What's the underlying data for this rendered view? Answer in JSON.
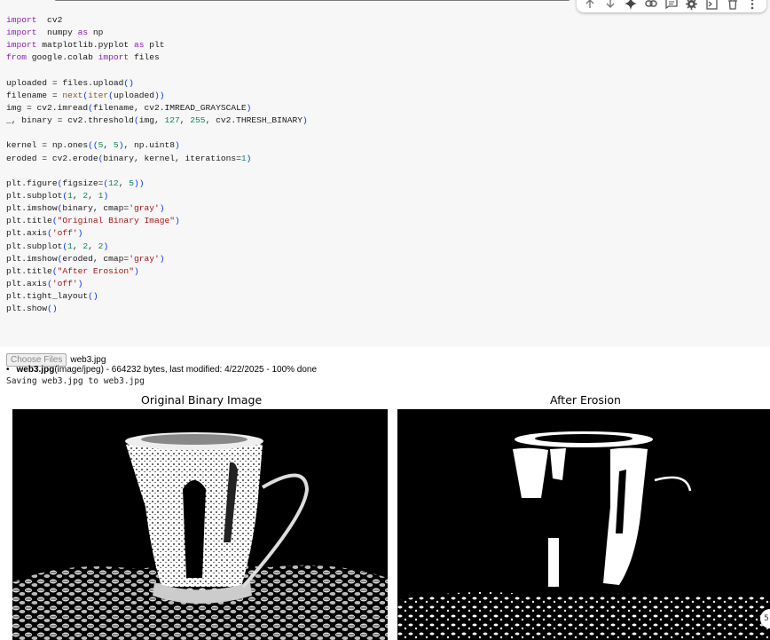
{
  "toolbar": {
    "icons": [
      "arrow-up-icon",
      "arrow-down-icon",
      "gemini-spark-icon",
      "link-icon",
      "comment-icon",
      "gear-icon",
      "mirror-cell-icon",
      "trash-icon",
      "more-vert-icon"
    ]
  },
  "code_lines": [
    [
      [
        "kw",
        "import"
      ],
      [
        "",
        "  cv2"
      ]
    ],
    [
      [
        "kw",
        "import"
      ],
      [
        "",
        "  numpy "
      ],
      [
        "kw",
        "as"
      ],
      [
        "",
        " np"
      ]
    ],
    [
      [
        "kw",
        "import"
      ],
      [
        "",
        " matplotlib.pyplot "
      ],
      [
        "kw",
        "as"
      ],
      [
        "",
        " plt"
      ]
    ],
    [
      [
        "kw",
        "from"
      ],
      [
        "",
        " google.colab "
      ],
      [
        "kw",
        "import"
      ],
      [
        "",
        " files"
      ]
    ],
    [],
    [
      [
        "",
        "uploaded = files.upload"
      ],
      [
        "pr",
        "()"
      ]
    ],
    [
      [
        "",
        "filename = "
      ],
      [
        "bi",
        "next"
      ],
      [
        "pr",
        "("
      ],
      [
        "bi",
        "iter"
      ],
      [
        "pr",
        "("
      ],
      [
        "",
        "uploaded"
      ],
      [
        "pr",
        "))"
      ]
    ],
    [
      [
        "",
        "img = cv2.imread"
      ],
      [
        "pr",
        "("
      ],
      [
        "",
        "filename, cv2.IMREAD_GRAYSCALE"
      ],
      [
        "pr",
        ")"
      ]
    ],
    [
      [
        "",
        "_, binary = cv2.threshold"
      ],
      [
        "pr",
        "("
      ],
      [
        "",
        "img, "
      ],
      [
        "nm",
        "127"
      ],
      [
        "",
        ", "
      ],
      [
        "nm",
        "255"
      ],
      [
        "",
        ", cv2.THRESH_BINARY"
      ],
      [
        "pr",
        ")"
      ]
    ],
    [],
    [
      [
        "",
        "kernel = np.ones"
      ],
      [
        "pr",
        "(("
      ],
      [
        "nm",
        "5"
      ],
      [
        "",
        ", "
      ],
      [
        "nm",
        "5"
      ],
      [
        "pr",
        ")"
      ],
      [
        "",
        ", np.uint8"
      ],
      [
        "pr",
        ")"
      ]
    ],
    [
      [
        "",
        "eroded = cv2.erode"
      ],
      [
        "pr",
        "("
      ],
      [
        "",
        "binary, kernel, iterations="
      ],
      [
        "nm",
        "1"
      ],
      [
        "pr",
        ")"
      ]
    ],
    [],
    [
      [
        "",
        "plt.figure"
      ],
      [
        "pr",
        "("
      ],
      [
        "",
        "figsize="
      ],
      [
        "pr",
        "("
      ],
      [
        "nm",
        "12"
      ],
      [
        "",
        ", "
      ],
      [
        "nm",
        "5"
      ],
      [
        "pr",
        "))"
      ]
    ],
    [
      [
        "",
        "plt.subplot"
      ],
      [
        "pr",
        "("
      ],
      [
        "nm",
        "1"
      ],
      [
        "",
        ", "
      ],
      [
        "nm",
        "2"
      ],
      [
        "",
        ", "
      ],
      [
        "nm",
        "1"
      ],
      [
        "pr",
        ")"
      ]
    ],
    [
      [
        "",
        "plt.imshow"
      ],
      [
        "pr",
        "("
      ],
      [
        "",
        "binary, cmap="
      ],
      [
        "st",
        "'gray'"
      ],
      [
        "pr",
        ")"
      ]
    ],
    [
      [
        "",
        "plt.title"
      ],
      [
        "pr",
        "("
      ],
      [
        "st",
        "\"Original Binary Image\""
      ],
      [
        "pr",
        ")"
      ]
    ],
    [
      [
        "",
        "plt.axis"
      ],
      [
        "pr",
        "("
      ],
      [
        "st",
        "'off'"
      ],
      [
        "pr",
        ")"
      ]
    ],
    [
      [
        "",
        "plt.subplot"
      ],
      [
        "pr",
        "("
      ],
      [
        "nm",
        "1"
      ],
      [
        "",
        ", "
      ],
      [
        "nm",
        "2"
      ],
      [
        "",
        ", "
      ],
      [
        "nm",
        "2"
      ],
      [
        "pr",
        ")"
      ]
    ],
    [
      [
        "",
        "plt.imshow"
      ],
      [
        "pr",
        "("
      ],
      [
        "",
        "eroded, cmap="
      ],
      [
        "st",
        "'gray'"
      ],
      [
        "pr",
        ")"
      ]
    ],
    [
      [
        "",
        "plt.title"
      ],
      [
        "pr",
        "("
      ],
      [
        "st",
        "\"After Erosion\""
      ],
      [
        "pr",
        ")"
      ]
    ],
    [
      [
        "",
        "plt.axis"
      ],
      [
        "pr",
        "("
      ],
      [
        "st",
        "'off'"
      ],
      [
        "pr",
        ")"
      ]
    ],
    [
      [
        "",
        "plt.tight_layout"
      ],
      [
        "pr",
        "()"
      ]
    ],
    [
      [
        "",
        "plt.show"
      ],
      [
        "pr",
        "()"
      ]
    ]
  ],
  "output": {
    "choose_files_label": "Choose Files",
    "chosen_file": "web3.jpg",
    "file_info_name": "web3.jpg",
    "file_info_rest": "(image/jpeg) - 664232 bytes, last modified: 4/22/2025 - 100% done",
    "saving_text": "Saving web3.jpg to web3.jpg",
    "plot1_title": "Original Binary Image",
    "plot2_title": "After Erosion"
  },
  "fab_label": "5"
}
